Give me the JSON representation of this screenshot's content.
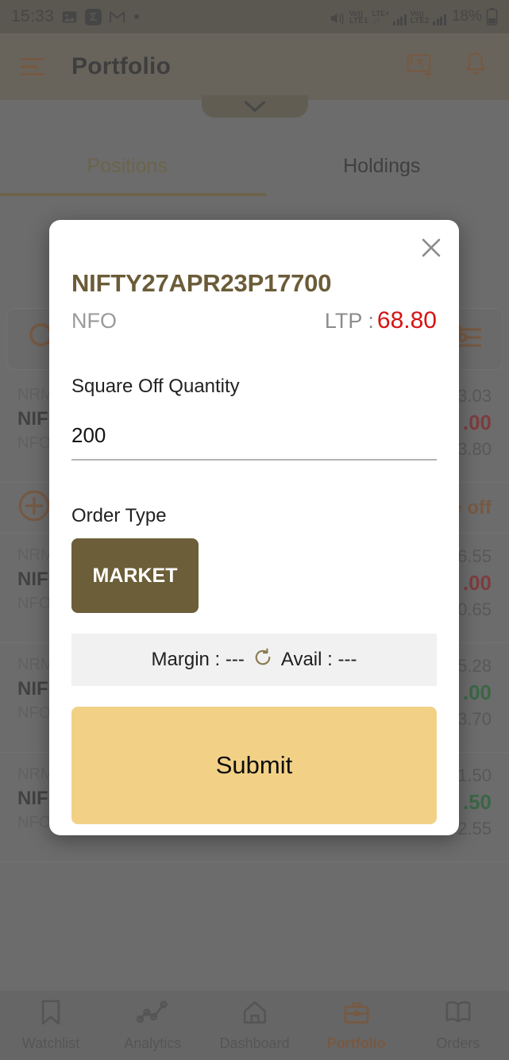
{
  "status_bar": {
    "time": "15:33",
    "icons": [
      "photos-icon",
      "sigma-icon",
      "gmail-icon",
      "dot-icon",
      "mute-icon"
    ],
    "sigma_glyph": "Σ",
    "gmail_glyph": "M",
    "sim1_top": "Vo))",
    "sim1_bottom": "LTE1",
    "lte_plus": "LTE+",
    "arrows": "↓↑",
    "sim2_top": "Vo))",
    "sim2_bottom": "LTE2",
    "battery_percent": "18%",
    "battery_glyph": "🔋"
  },
  "app_bar": {
    "title": "Portfolio",
    "menu_icon": "hamburger-menu-icon",
    "add_funds_icon": "add-funds-rupee-icon",
    "notifications_icon": "bell-icon",
    "accent": "#a3581f"
  },
  "tabs": [
    {
      "label": "Positions",
      "active": true
    },
    {
      "label": "Holdings",
      "active": false
    }
  ],
  "search_row": {
    "search_icon": "search-icon",
    "filter_icon": "filter-sliders-icon"
  },
  "positions": [
    {
      "tag": "NRML",
      "symbol": "NIF",
      "exchange": "NFO",
      "v1": "3.03",
      "v2": ".00",
      "dir": "down",
      "v3": "3.80"
    },
    {
      "tag": "NRML",
      "symbol": "NIF",
      "exchange": "NFO",
      "v1": "6.55",
      "v2": ".00",
      "dir": "down",
      "v3": "0.65"
    },
    {
      "tag": "NRML",
      "symbol": "NIF",
      "exchange": "NFO",
      "v1": "5.28",
      "v2": ".00",
      "dir": "up",
      "v3": "3.70"
    },
    {
      "tag": "NRML",
      "symbol": "NIF",
      "exchange": "NFO",
      "v1": "1.50",
      "v2": ".50",
      "dir": "up",
      "v3": "2.55"
    }
  ],
  "inline_action": {
    "add_icon": "add-circle-icon",
    "square_off_label": "e off"
  },
  "modal": {
    "close_icon": "close-icon",
    "symbol": "NIFTY27APR23P17700",
    "exchange": "NFO",
    "ltp_label": "LTP :",
    "ltp_value": "68.80",
    "ltp_color": "#d61414",
    "quantity_label": "Square Off Quantity",
    "quantity_value": "200",
    "order_type_label": "Order Type",
    "order_type_selected": "MARKET",
    "order_type_color": "#6b5e38",
    "margin_label": "Margin : ---",
    "refresh_icon": "refresh-icon",
    "avail_label": "Avail : ---",
    "submit_label": "Submit",
    "submit_color": "#f2d187"
  },
  "bottom_nav": [
    {
      "label": "Watchlist",
      "icon": "bookmark-icon",
      "active": false
    },
    {
      "label": "Analytics",
      "icon": "line-chart-icon",
      "active": false
    },
    {
      "label": "Dashboard",
      "icon": "home-icon",
      "active": false
    },
    {
      "label": "Portfolio",
      "icon": "briefcase-icon",
      "active": true
    },
    {
      "label": "Orders",
      "icon": "book-icon",
      "active": false
    }
  ]
}
